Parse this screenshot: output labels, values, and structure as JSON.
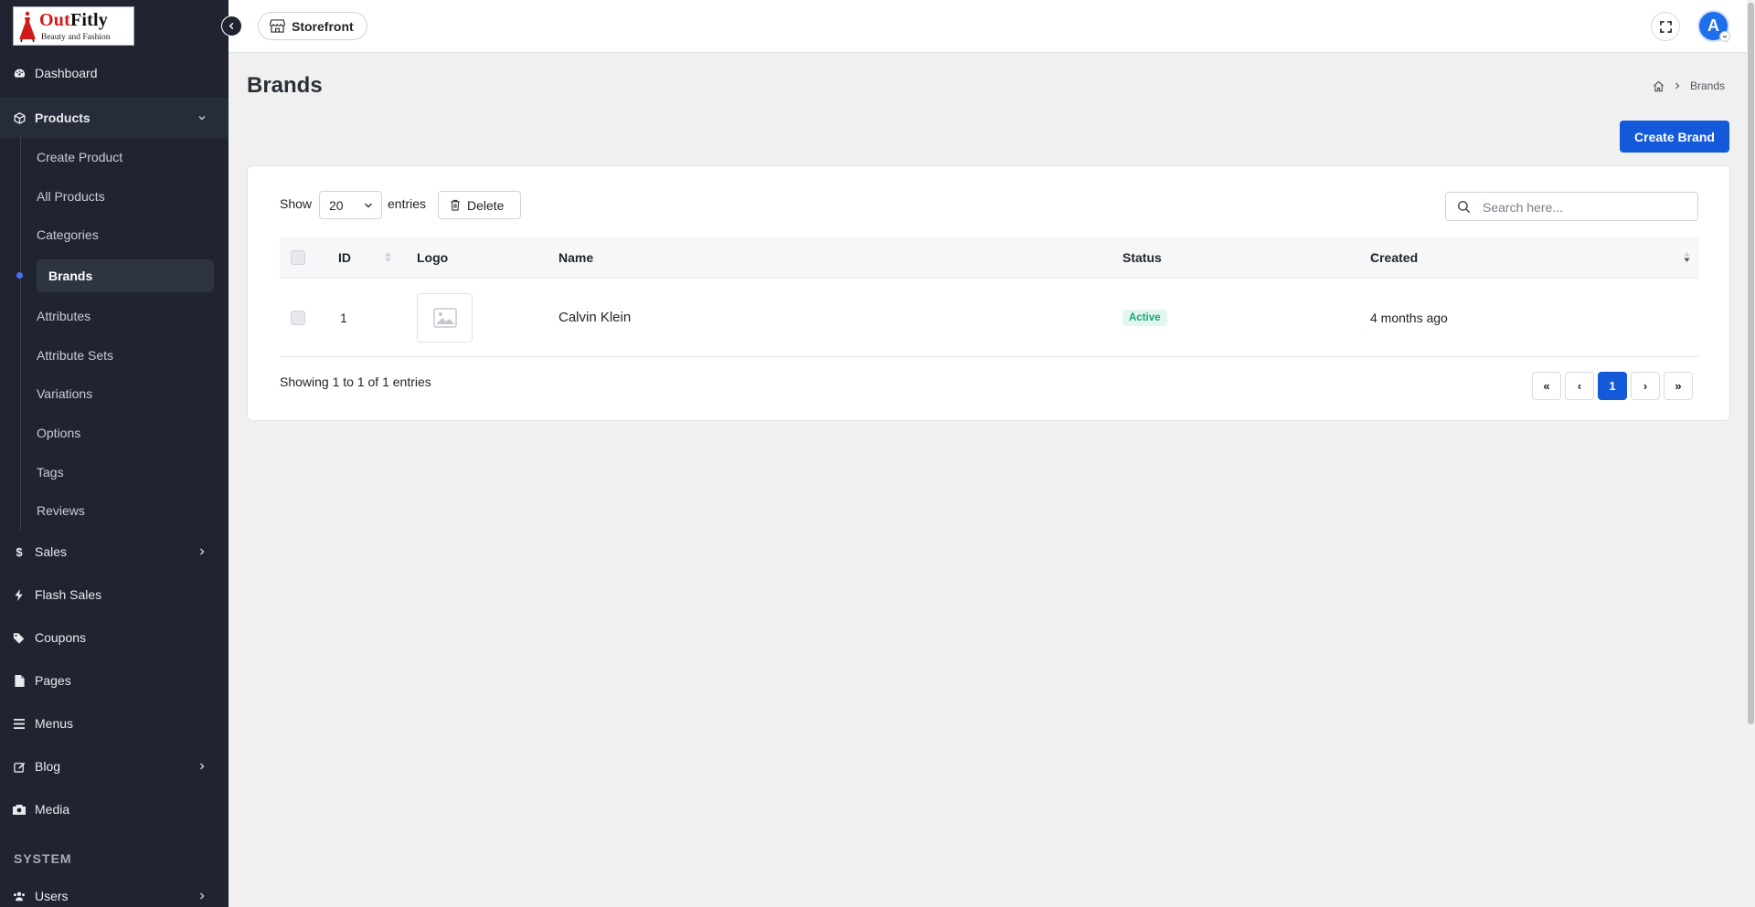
{
  "logo": {
    "name_red": "Out",
    "name_dark": "Fitly",
    "tagline": "Beauty and Fashion"
  },
  "sidebar": {
    "dashboard": "Dashboard",
    "products": "Products",
    "products_sub": {
      "create_product": "Create Product",
      "all_products": "All Products",
      "categories": "Categories",
      "brands": "Brands",
      "attributes": "Attributes",
      "attribute_sets": "Attribute Sets",
      "variations": "Variations",
      "options": "Options",
      "tags": "Tags",
      "reviews": "Reviews"
    },
    "sales": "Sales",
    "flash_sales": "Flash Sales",
    "coupons": "Coupons",
    "pages": "Pages",
    "menus": "Menus",
    "blog": "Blog",
    "media": "Media",
    "section_system": "SYSTEM",
    "users": "Users"
  },
  "topbar": {
    "storefront": "Storefront",
    "avatar_initial": "A"
  },
  "page": {
    "title": "Brands",
    "breadcrumb_current": "Brands",
    "create_button": "Create Brand"
  },
  "table": {
    "show_label": "Show",
    "entries_value": "20",
    "entries_label": "entries",
    "delete_label": "Delete",
    "search_placeholder": "Search here...",
    "columns": {
      "id": "ID",
      "logo": "Logo",
      "name": "Name",
      "status": "Status",
      "created": "Created"
    },
    "rows": [
      {
        "id": "1",
        "name": "Calvin Klein",
        "status": "Active",
        "created": "4 months ago"
      }
    ],
    "showing": "Showing 1 to 1 of 1 entries",
    "pagination": {
      "first": "«",
      "prev": "‹",
      "current": "1",
      "next": "›",
      "last": "»"
    }
  },
  "colors": {
    "sidebar_bg": "#1f2430",
    "primary": "#1459d9",
    "active_badge": "#17a673"
  }
}
